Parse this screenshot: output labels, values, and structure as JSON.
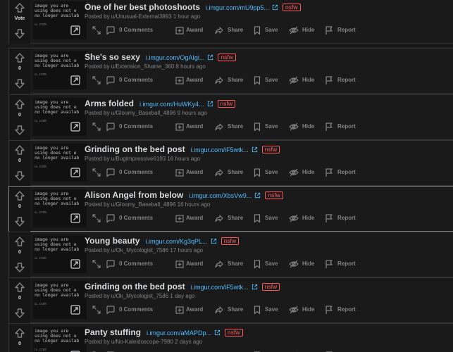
{
  "feed": {
    "thumbnail_text": "image you are\nusing does not e\nno longer availab",
    "thumbnail_sub": "u.com",
    "labels": {
      "comments": "0 Comments",
      "award": "Award",
      "share": "Share",
      "save": "Save",
      "hide": "Hide",
      "report": "Report"
    },
    "posts": [
      {
        "score": "Vote",
        "title": "One of her best photoshoots",
        "domain": "i.imgur.com/mU9pp5...",
        "nsfw": "nsfw",
        "meta": "Posted by u/Unusual-External3893 1 hour ago"
      },
      {
        "score": "0",
        "title": "She's so sexy",
        "domain": "i.imgur.com/OgAIgi...",
        "nsfw": "nsfw",
        "meta": "Posted by u/Extension_Shame_360 8 hours ago"
      },
      {
        "score": "0",
        "title": "Arms folded",
        "domain": "i.imgur.com/HuWKy4...",
        "nsfw": "nsfw",
        "meta": "Posted by u/Gloomy_Baseball_4896 9 hours ago"
      },
      {
        "score": "0",
        "title": "Grinding on the bed post",
        "domain": "i.imgur.com/iF5wtk...",
        "nsfw": "nsfw",
        "meta": "Posted by u/BugImpressive6193 16 hours ago"
      },
      {
        "score": "0",
        "title": "Alison Angel from below",
        "domain": "i.imgur.com/XbsVw9...",
        "nsfw": "nsfw",
        "meta": "Posted by u/Gloomy_Baseball_4896 16 hours ago"
      },
      {
        "score": "0",
        "title": "Young beauty",
        "domain": "i.imgur.com/Kg3qPL...",
        "nsfw": "nsfw",
        "meta": "Posted by u/Ok_Mycologist_7586 17 hours ago"
      },
      {
        "score": "0",
        "title": "Grinding on the bed post",
        "domain": "i.imgur.com/iF5wtk...",
        "nsfw": "nsfw",
        "meta": "Posted by u/Ok_Mycologist_7586 1 day ago"
      },
      {
        "score": "0",
        "title": "Panty stuffing",
        "domain": "i.imgur.com/aMAPDp...",
        "nsfw": "nsfw",
        "meta": "Posted by u/No-Kaleidoscope-7980 2 days ago"
      }
    ]
  }
}
